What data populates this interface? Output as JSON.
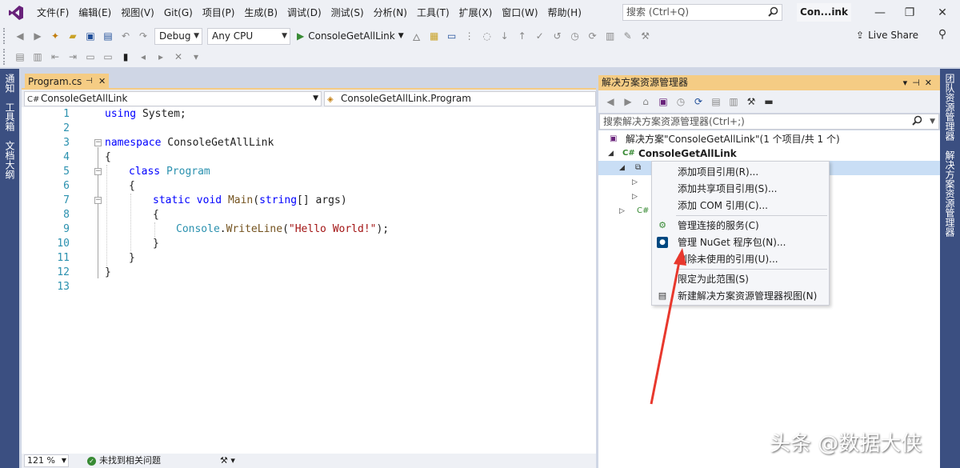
{
  "menubar": {
    "items": [
      "文件(F)",
      "编辑(E)",
      "视图(V)",
      "Git(G)",
      "项目(P)",
      "生成(B)",
      "调试(D)",
      "测试(S)",
      "分析(N)",
      "工具(T)",
      "扩展(X)",
      "窗口(W)",
      "帮助(H)"
    ],
    "search_placeholder": "搜索 (Ctrl+Q)",
    "solution_name": "Con...ink"
  },
  "toolbar": {
    "config": "Debug",
    "platform": "Any CPU",
    "run_target": "ConsoleGetAllLink",
    "live_share": "Live Share"
  },
  "left_tabs": [
    "通知",
    "工具箱",
    "文档大纲"
  ],
  "right_tabs": [
    "团队资源管理器",
    "解决方案资源管理器"
  ],
  "editor": {
    "tab_title": "Program.cs",
    "nav_project": "ConsoleGetAllLink",
    "nav_class": "ConsoleGetAllLink.Program",
    "line_numbers": [
      "1",
      "2",
      "3",
      "4",
      "5",
      "6",
      "7",
      "8",
      "9",
      "10",
      "11",
      "12",
      "13"
    ],
    "code": {
      "l1_kw": "using",
      "l1_rest": " System;",
      "l3_kw": "namespace",
      "l3_rest": " ConsoleGetAllLink",
      "l4": "{",
      "l5_kw": "class",
      "l5_type": "Program",
      "l6": "{",
      "l7_kw1": "static",
      "l7_kw2": "void",
      "l7_fn": "Main",
      "l7_open": "(",
      "l7_kw3": "string",
      "l7_rest": "[] args)",
      "l8": "{",
      "l9_type": "Console",
      "l9_dot": ".",
      "l9_fn": "WriteLine",
      "l9_open": "(",
      "l9_str": "\"Hello World!\"",
      "l9_close": ");",
      "l10": "}",
      "l11": "}",
      "l12": "}"
    },
    "zoom": "121 %",
    "issues": "未找到相关问题"
  },
  "solution_explorer": {
    "title": "解决方案资源管理器",
    "search_placeholder": "搜索解决方案资源管理器(Ctrl+;)",
    "solution_label": "解决方案\"ConsoleGetAllLink\"(1 个项目/共 1 个)",
    "project_label": "ConsoleGetAllLink"
  },
  "context_menu": {
    "items": [
      "添加项目引用(R)...",
      "添加共享项目引用(S)...",
      "添加 COM 引用(C)...",
      "管理连接的服务(C)",
      "管理 NuGet 程序包(N)...",
      "删除未使用的引用(U)...",
      "限定为此范围(S)",
      "新建解决方案资源管理器视图(N)"
    ]
  },
  "watermark": "头条 @数据大侠",
  "colors": {
    "accent_tab": "#f5cc84",
    "tool_strip": "#3b4f81",
    "annotation_arrow": "#e8382d"
  }
}
